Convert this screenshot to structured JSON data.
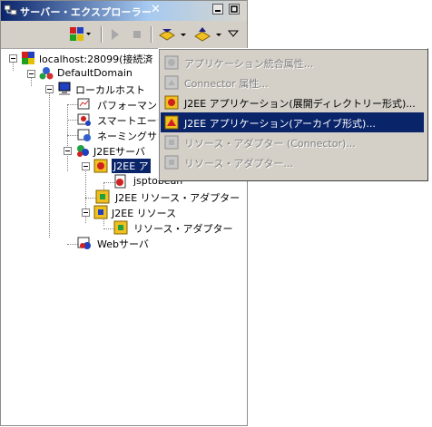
{
  "view": {
    "title": "サーバー・エクスプローラー",
    "close_glyph": "✕"
  },
  "toolbar": {
    "icons": [
      "layout-icon",
      "run-icon",
      "stop-icon",
      "deploy-dropdown-icon",
      "import-dropdown-icon",
      "view-menu-icon"
    ]
  },
  "tree": {
    "nodes": [
      {
        "label": "localhost:28099(接続済"
      },
      {
        "label": "DefaultDomain"
      },
      {
        "label": "ローカルホスト"
      },
      {
        "label": "パフォーマンス"
      },
      {
        "label": "スマートエージ"
      },
      {
        "label": "ネーミングサー"
      },
      {
        "label": "J2EEサーバ"
      },
      {
        "label": "J2EE ア"
      },
      {
        "label": "jsptobean"
      },
      {
        "label": "J2EE リソース・アダプター"
      },
      {
        "label": "J2EE リソース"
      },
      {
        "label": "リソース・アダプター"
      },
      {
        "label": "Webサーバ"
      }
    ]
  },
  "menu": {
    "items": [
      {
        "label": "アプリケーション統合属性...",
        "enabled": false
      },
      {
        "label": "Connector 属性...",
        "enabled": false
      },
      {
        "label": "J2EE アプリケーション(展開ディレクトリー形式)...",
        "enabled": true
      },
      {
        "label": "J2EE アプリケーション(アーカイブ形式)...",
        "enabled": true,
        "highlighted": true
      },
      {
        "label": "リソース・アダプター (Connector)...",
        "enabled": false
      },
      {
        "label": "リソース・アダプター...",
        "enabled": false
      }
    ]
  },
  "colors": {
    "selection": "#0a246a",
    "face": "#d4d0c8"
  }
}
